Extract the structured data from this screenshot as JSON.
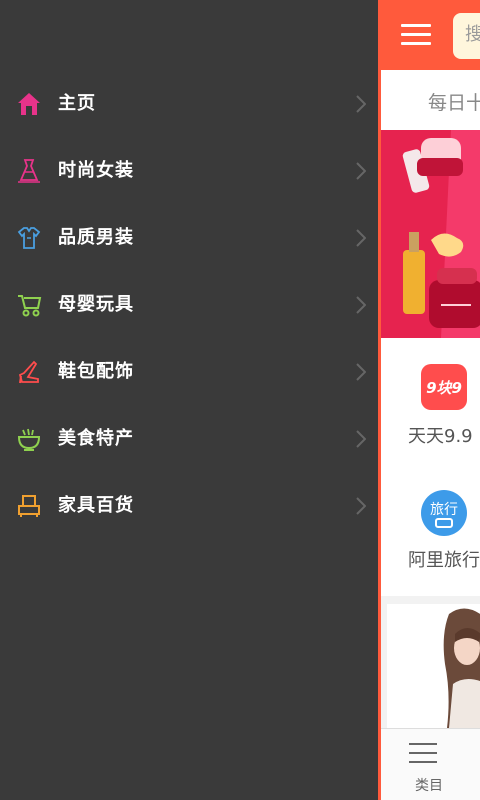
{
  "drawer": {
    "items": [
      {
        "label": "主页",
        "icon": "home-icon",
        "color": "#e8338a"
      },
      {
        "label": "时尚女装",
        "icon": "dress-icon",
        "color": "#e8338a"
      },
      {
        "label": "品质男装",
        "icon": "shirt-icon",
        "color": "#4a9fe0"
      },
      {
        "label": "母婴玩具",
        "icon": "stroller-icon",
        "color": "#8fd14f"
      },
      {
        "label": "鞋包配饰",
        "icon": "high-heel-icon",
        "color": "#ff4d4d"
      },
      {
        "label": "美食特产",
        "icon": "food-bowl-icon",
        "color": "#8fd14f"
      },
      {
        "label": "家具百货",
        "icon": "furniture-icon",
        "color": "#f0a030"
      }
    ]
  },
  "main": {
    "search_placeholder": "搜",
    "subheader": "每日十",
    "shortcuts": [
      {
        "badge": "9块9",
        "label": "天天9.9",
        "color": "#ff4d4d"
      },
      {
        "badge": "旅行",
        "label": "阿里旅行",
        "color": "#3d9be9"
      }
    ],
    "bottom_nav": {
      "category_label": "类目"
    }
  },
  "colors": {
    "accent": "#ff5a3c",
    "drawer_bg": "#3a3a3a"
  }
}
